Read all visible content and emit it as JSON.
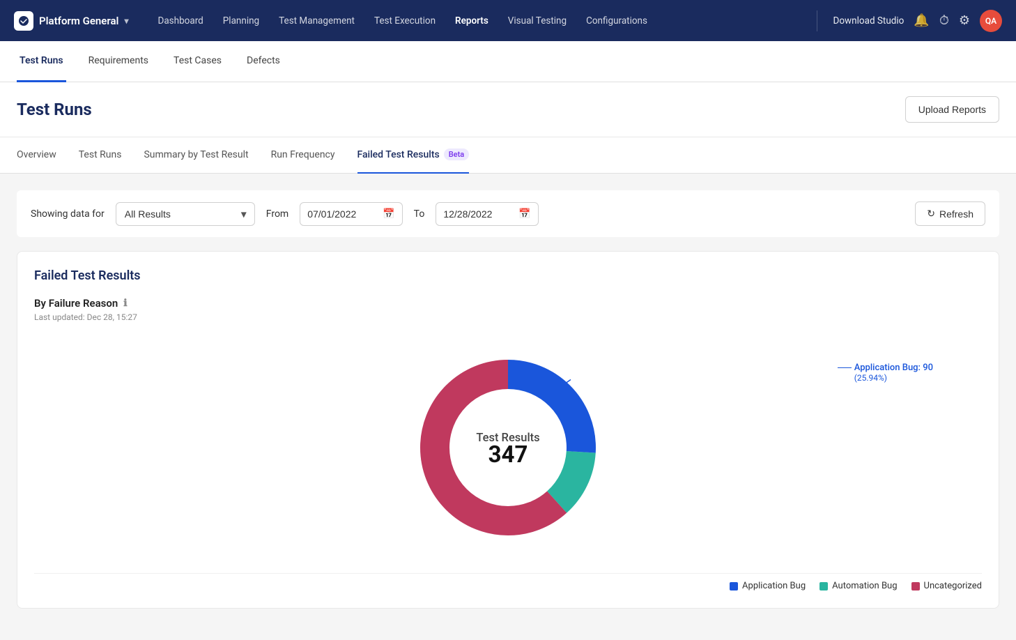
{
  "nav": {
    "brand": "Platform General",
    "chevron": "▾",
    "links": [
      {
        "label": "Dashboard",
        "active": false
      },
      {
        "label": "Planning",
        "active": false
      },
      {
        "label": "Test Management",
        "active": false
      },
      {
        "label": "Test Execution",
        "active": false
      },
      {
        "label": "Reports",
        "active": true
      },
      {
        "label": "Visual Testing",
        "active": false
      },
      {
        "label": "Configurations",
        "active": false
      }
    ],
    "download_studio": "Download Studio",
    "avatar": "QA"
  },
  "sub_nav": {
    "tabs": [
      {
        "label": "Test Runs",
        "active": true
      },
      {
        "label": "Requirements",
        "active": false
      },
      {
        "label": "Test Cases",
        "active": false
      },
      {
        "label": "Defects",
        "active": false
      }
    ]
  },
  "page_header": {
    "title": "Test Runs",
    "upload_button": "Upload Reports"
  },
  "content_nav": {
    "tabs": [
      {
        "label": "Overview",
        "active": false,
        "beta": false
      },
      {
        "label": "Test Runs",
        "active": false,
        "beta": false
      },
      {
        "label": "Summary by Test Result",
        "active": false,
        "beta": false
      },
      {
        "label": "Run Frequency",
        "active": false,
        "beta": false
      },
      {
        "label": "Failed Test Results",
        "active": true,
        "beta": true,
        "beta_label": "Beta"
      }
    ]
  },
  "filter_bar": {
    "showing_label": "Showing data for",
    "select_value": "All Results",
    "from_label": "From",
    "from_date": "07/01/2022",
    "to_label": "To",
    "to_date": "12/28/2022",
    "refresh_label": "Refresh"
  },
  "failed_results": {
    "section_title": "Failed Test Results",
    "chart_title": "By Failure Reason",
    "last_updated": "Last updated: Dec 28, 15:27",
    "center_label": "Test Results",
    "center_value": "347",
    "annotation_label": "Application Bug: 90",
    "annotation_sub": "(25.94%)",
    "segments": [
      {
        "label": "Application Bug",
        "color": "#1a56db",
        "value": 90,
        "percent": 25.94
      },
      {
        "label": "Automation Bug",
        "color": "#2ab5a0",
        "value": 43,
        "percent": 12.39
      },
      {
        "label": "Uncategorized",
        "color": "#c0395e",
        "value": 214,
        "percent": 61.67
      }
    ],
    "legend": [
      {
        "label": "Application Bug",
        "color": "#1a56db"
      },
      {
        "label": "Automation Bug",
        "color": "#2ab5a0"
      },
      {
        "label": "Uncategorized",
        "color": "#c0395e"
      }
    ]
  }
}
